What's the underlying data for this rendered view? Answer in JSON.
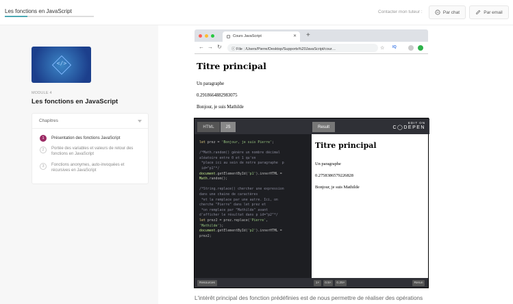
{
  "header": {
    "course_title": "Les fonctions en JavaScript",
    "progress": 0.25,
    "contact_label": "Contacter mon tuteur :",
    "chat_button": "Par chat",
    "email_button": "Par email"
  },
  "sidebar": {
    "thumb_symbol": "</>",
    "module_label": "MODULE 4",
    "module_title": "Les fonctions en JavaScript",
    "chapters_title": "Chapitres",
    "chapters": [
      {
        "num": "1",
        "label": "Présentation des fonctions JavaScript"
      },
      {
        "num": "2",
        "label": "Portée des variables et valeurs de retour des fonctions en JavaScript"
      },
      {
        "num": "3",
        "label": "Fonctions anonymes, auto-invoquées et récursives en JavaScript"
      }
    ]
  },
  "browser": {
    "tab_title": "Cours JavaScript",
    "url_prefix": "File",
    "url": "/Users/Pierre/Desktop/Supports%20JavaScript/cour…",
    "ext_label": "IQ"
  },
  "page_render": {
    "title": "Titre principal",
    "p1": "Un paragraphe",
    "p2": "0.2918664882983075",
    "p3": "Bonjour, je suis Mathilde"
  },
  "codepen": {
    "tab_html": "HTML",
    "tab_js": "JS",
    "tab_result": "Result",
    "edit_on": "EDIT ON",
    "brand": "C◯DEPEN",
    "result_title": "Titre principal",
    "result_p1": "Un paragraphe",
    "result_p2": "0.2758386579226828",
    "result_p3": "Bonjour, je suis Mathilde",
    "footer_resources": "Resources",
    "zoom_options": [
      "1×",
      "0.5×",
      "0.25×"
    ],
    "rerun": "Rerun"
  },
  "bottom_text": "L'intérêt principal des fonction prédéfinies est de nous permettre de réaliser des opérations"
}
